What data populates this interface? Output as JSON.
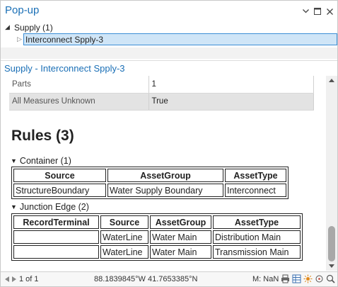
{
  "window": {
    "title": "Pop-up"
  },
  "tree": {
    "layer_label": "Supply (1)",
    "feature_label": "Interconnect Spply-3"
  },
  "section_title": "Supply - Interconnect Spply-3",
  "attributes": [
    {
      "key": "Parts",
      "value": "1"
    },
    {
      "key": "All Measures Unknown",
      "value": "True"
    }
  ],
  "rules": {
    "heading": "Rules (3)",
    "container": {
      "label": "Container (1)",
      "headers": [
        "Source",
        "AssetGroup",
        "AssetType"
      ],
      "rows": [
        [
          "StructureBoundary",
          "Water Supply Boundary",
          "Interconnect"
        ]
      ]
    },
    "junction_edge": {
      "label": "Junction Edge (2)",
      "headers": [
        "RecordTerminal",
        "Source",
        "AssetGroup",
        "AssetType"
      ],
      "rows": [
        [
          "",
          "WaterLine",
          "Water Main",
          "Distribution Main"
        ],
        [
          "",
          "WaterLine",
          "Water Main",
          "Transmission Main"
        ]
      ]
    }
  },
  "footer": {
    "pager": "1 of 1",
    "coordinates": "88.1839845°W 41.7653385°N",
    "m_value": "M: NaN"
  },
  "colors": {
    "accent": "#1a6fb6",
    "selection": "#cfe5f7"
  }
}
